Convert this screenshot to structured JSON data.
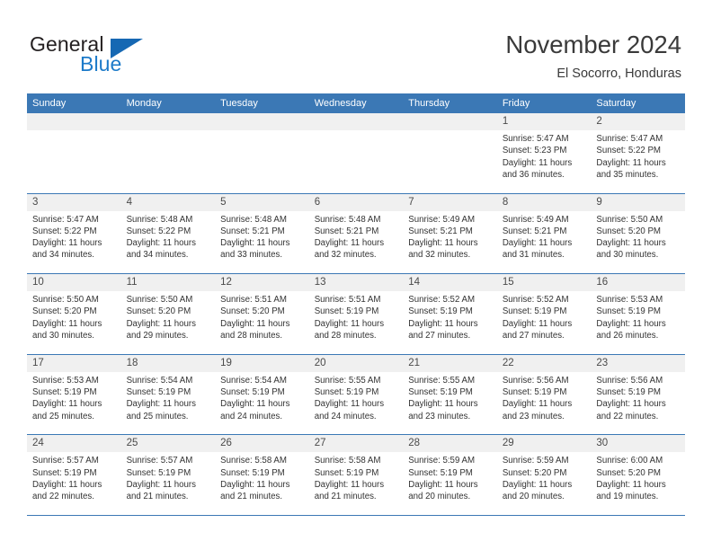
{
  "brand": {
    "name_part1": "General",
    "name_part2": "Blue",
    "triangle_color": "#1668b3",
    "blue_text_color": "#1c7ac9"
  },
  "header": {
    "title": "November 2024",
    "location": "El Socorro, Honduras",
    "header_bg": "#3b78b5",
    "day_bar_bg": "#f0f0f0"
  },
  "weekday_headers": [
    "Sunday",
    "Monday",
    "Tuesday",
    "Wednesday",
    "Thursday",
    "Friday",
    "Saturday"
  ],
  "labels": {
    "sunrise_prefix": "Sunrise:",
    "sunset_prefix": "Sunset:",
    "daylight_prefix": "Daylight:"
  },
  "weeks": [
    [
      {
        "day": "",
        "empty": true
      },
      {
        "day": "",
        "empty": true
      },
      {
        "day": "",
        "empty": true
      },
      {
        "day": "",
        "empty": true
      },
      {
        "day": "",
        "empty": true
      },
      {
        "day": "1",
        "sunrise": "Sunrise: 5:47 AM",
        "sunset": "Sunset: 5:23 PM",
        "daylight1": "Daylight: 11 hours",
        "daylight2": "and 36 minutes."
      },
      {
        "day": "2",
        "sunrise": "Sunrise: 5:47 AM",
        "sunset": "Sunset: 5:22 PM",
        "daylight1": "Daylight: 11 hours",
        "daylight2": "and 35 minutes."
      }
    ],
    [
      {
        "day": "3",
        "sunrise": "Sunrise: 5:47 AM",
        "sunset": "Sunset: 5:22 PM",
        "daylight1": "Daylight: 11 hours",
        "daylight2": "and 34 minutes."
      },
      {
        "day": "4",
        "sunrise": "Sunrise: 5:48 AM",
        "sunset": "Sunset: 5:22 PM",
        "daylight1": "Daylight: 11 hours",
        "daylight2": "and 34 minutes."
      },
      {
        "day": "5",
        "sunrise": "Sunrise: 5:48 AM",
        "sunset": "Sunset: 5:21 PM",
        "daylight1": "Daylight: 11 hours",
        "daylight2": "and 33 minutes."
      },
      {
        "day": "6",
        "sunrise": "Sunrise: 5:48 AM",
        "sunset": "Sunset: 5:21 PM",
        "daylight1": "Daylight: 11 hours",
        "daylight2": "and 32 minutes."
      },
      {
        "day": "7",
        "sunrise": "Sunrise: 5:49 AM",
        "sunset": "Sunset: 5:21 PM",
        "daylight1": "Daylight: 11 hours",
        "daylight2": "and 32 minutes."
      },
      {
        "day": "8",
        "sunrise": "Sunrise: 5:49 AM",
        "sunset": "Sunset: 5:21 PM",
        "daylight1": "Daylight: 11 hours",
        "daylight2": "and 31 minutes."
      },
      {
        "day": "9",
        "sunrise": "Sunrise: 5:50 AM",
        "sunset": "Sunset: 5:20 PM",
        "daylight1": "Daylight: 11 hours",
        "daylight2": "and 30 minutes."
      }
    ],
    [
      {
        "day": "10",
        "sunrise": "Sunrise: 5:50 AM",
        "sunset": "Sunset: 5:20 PM",
        "daylight1": "Daylight: 11 hours",
        "daylight2": "and 30 minutes."
      },
      {
        "day": "11",
        "sunrise": "Sunrise: 5:50 AM",
        "sunset": "Sunset: 5:20 PM",
        "daylight1": "Daylight: 11 hours",
        "daylight2": "and 29 minutes."
      },
      {
        "day": "12",
        "sunrise": "Sunrise: 5:51 AM",
        "sunset": "Sunset: 5:20 PM",
        "daylight1": "Daylight: 11 hours",
        "daylight2": "and 28 minutes."
      },
      {
        "day": "13",
        "sunrise": "Sunrise: 5:51 AM",
        "sunset": "Sunset: 5:19 PM",
        "daylight1": "Daylight: 11 hours",
        "daylight2": "and 28 minutes."
      },
      {
        "day": "14",
        "sunrise": "Sunrise: 5:52 AM",
        "sunset": "Sunset: 5:19 PM",
        "daylight1": "Daylight: 11 hours",
        "daylight2": "and 27 minutes."
      },
      {
        "day": "15",
        "sunrise": "Sunrise: 5:52 AM",
        "sunset": "Sunset: 5:19 PM",
        "daylight1": "Daylight: 11 hours",
        "daylight2": "and 27 minutes."
      },
      {
        "day": "16",
        "sunrise": "Sunrise: 5:53 AM",
        "sunset": "Sunset: 5:19 PM",
        "daylight1": "Daylight: 11 hours",
        "daylight2": "and 26 minutes."
      }
    ],
    [
      {
        "day": "17",
        "sunrise": "Sunrise: 5:53 AM",
        "sunset": "Sunset: 5:19 PM",
        "daylight1": "Daylight: 11 hours",
        "daylight2": "and 25 minutes."
      },
      {
        "day": "18",
        "sunrise": "Sunrise: 5:54 AM",
        "sunset": "Sunset: 5:19 PM",
        "daylight1": "Daylight: 11 hours",
        "daylight2": "and 25 minutes."
      },
      {
        "day": "19",
        "sunrise": "Sunrise: 5:54 AM",
        "sunset": "Sunset: 5:19 PM",
        "daylight1": "Daylight: 11 hours",
        "daylight2": "and 24 minutes."
      },
      {
        "day": "20",
        "sunrise": "Sunrise: 5:55 AM",
        "sunset": "Sunset: 5:19 PM",
        "daylight1": "Daylight: 11 hours",
        "daylight2": "and 24 minutes."
      },
      {
        "day": "21",
        "sunrise": "Sunrise: 5:55 AM",
        "sunset": "Sunset: 5:19 PM",
        "daylight1": "Daylight: 11 hours",
        "daylight2": "and 23 minutes."
      },
      {
        "day": "22",
        "sunrise": "Sunrise: 5:56 AM",
        "sunset": "Sunset: 5:19 PM",
        "daylight1": "Daylight: 11 hours",
        "daylight2": "and 23 minutes."
      },
      {
        "day": "23",
        "sunrise": "Sunrise: 5:56 AM",
        "sunset": "Sunset: 5:19 PM",
        "daylight1": "Daylight: 11 hours",
        "daylight2": "and 22 minutes."
      }
    ],
    [
      {
        "day": "24",
        "sunrise": "Sunrise: 5:57 AM",
        "sunset": "Sunset: 5:19 PM",
        "daylight1": "Daylight: 11 hours",
        "daylight2": "and 22 minutes."
      },
      {
        "day": "25",
        "sunrise": "Sunrise: 5:57 AM",
        "sunset": "Sunset: 5:19 PM",
        "daylight1": "Daylight: 11 hours",
        "daylight2": "and 21 minutes."
      },
      {
        "day": "26",
        "sunrise": "Sunrise: 5:58 AM",
        "sunset": "Sunset: 5:19 PM",
        "daylight1": "Daylight: 11 hours",
        "daylight2": "and 21 minutes."
      },
      {
        "day": "27",
        "sunrise": "Sunrise: 5:58 AM",
        "sunset": "Sunset: 5:19 PM",
        "daylight1": "Daylight: 11 hours",
        "daylight2": "and 21 minutes."
      },
      {
        "day": "28",
        "sunrise": "Sunrise: 5:59 AM",
        "sunset": "Sunset: 5:19 PM",
        "daylight1": "Daylight: 11 hours",
        "daylight2": "and 20 minutes."
      },
      {
        "day": "29",
        "sunrise": "Sunrise: 5:59 AM",
        "sunset": "Sunset: 5:20 PM",
        "daylight1": "Daylight: 11 hours",
        "daylight2": "and 20 minutes."
      },
      {
        "day": "30",
        "sunrise": "Sunrise: 6:00 AM",
        "sunset": "Sunset: 5:20 PM",
        "daylight1": "Daylight: 11 hours",
        "daylight2": "and 19 minutes."
      }
    ]
  ]
}
